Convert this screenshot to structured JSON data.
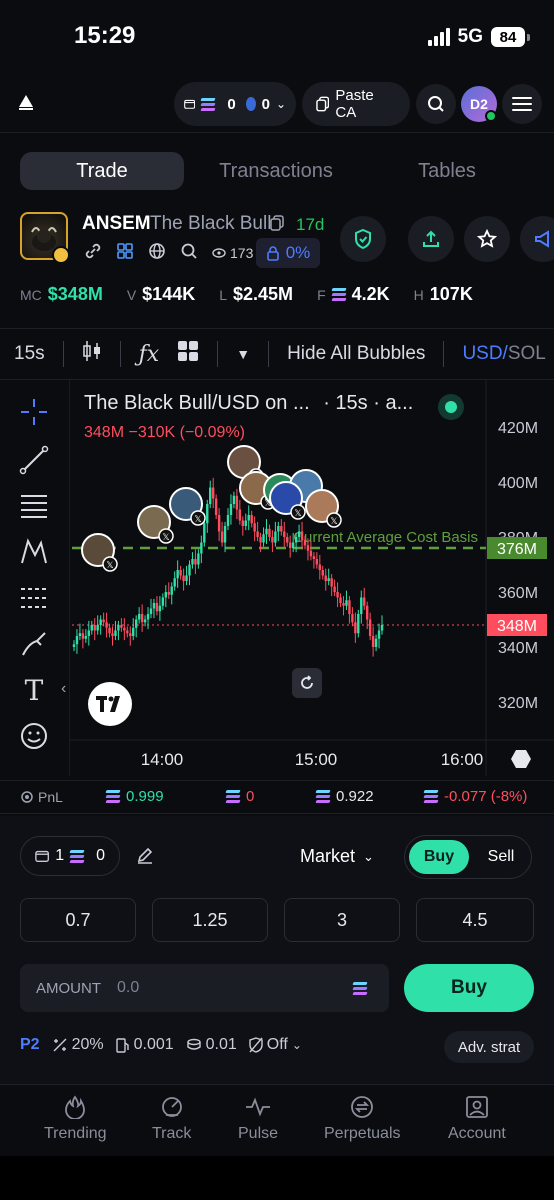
{
  "status": {
    "time": "15:29",
    "network": "5G",
    "battery": "84"
  },
  "header": {
    "wallet_count": "0",
    "points_count": "0",
    "paste_label": "Paste CA",
    "avatar_initials": "D2"
  },
  "tabs": [
    {
      "label": "Trade",
      "active": true
    },
    {
      "label": "Transactions",
      "active": false
    },
    {
      "label": "Tables",
      "active": false
    }
  ],
  "token": {
    "symbol": "ANSEM",
    "name": "The Black Bull",
    "age": "17d",
    "viewers": "173",
    "lock_pct": "0%"
  },
  "stats": [
    {
      "key": "MC",
      "value": "$348M",
      "color": "#2fe0a8"
    },
    {
      "key": "V",
      "value": "$144K",
      "color": "#ffffff"
    },
    {
      "key": "L",
      "value": "$2.45M",
      "color": "#ffffff"
    },
    {
      "key": "F",
      "value": "4.2K",
      "color": "#ffffff"
    },
    {
      "key": "H",
      "value": "107K",
      "color": "#ffffff"
    }
  ],
  "chart_toolbar": {
    "interval": "15s",
    "hide_bubbles": "Hide All Bubbles",
    "currency": "USD/SOL"
  },
  "chart": {
    "title": "The Black Bull/USD on ...",
    "subtitle": "· 15s · a...",
    "ohlc_line": "348M  −310K (−0.09%)",
    "avg_cost_label": "Current Average Cost Basis",
    "avg_cost_value": "376M",
    "current_value": "348M",
    "y_ticks": [
      "420M",
      "400M",
      "380M",
      "360M",
      "340M",
      "320M"
    ],
    "x_ticks": [
      "14:00",
      "15:00",
      "16:00"
    ]
  },
  "chart_data": {
    "type": "candlestick",
    "ylim": [
      310,
      430
    ],
    "y_unit": "M",
    "avg_cost": 376,
    "last": 348,
    "x_ticks": [
      "14:00",
      "15:00",
      "16:00"
    ],
    "close": [
      341,
      344,
      345,
      343,
      344,
      346,
      348,
      346,
      348,
      350,
      349,
      347,
      345,
      344,
      346,
      348,
      347,
      346,
      345,
      344,
      347,
      350,
      352,
      349,
      350,
      352,
      354,
      356,
      353,
      355,
      358,
      360,
      359,
      362,
      365,
      368,
      366,
      364,
      366,
      370,
      372,
      370,
      374,
      378,
      385,
      392,
      398,
      394,
      388,
      382,
      378,
      384,
      388,
      392,
      395,
      390,
      386,
      384,
      386,
      388,
      385,
      382,
      380,
      378,
      381,
      383,
      380,
      378,
      382,
      384,
      382,
      380,
      378,
      376,
      378,
      380,
      382,
      379,
      377,
      375,
      373,
      372,
      370,
      368,
      366,
      364,
      365,
      362,
      360,
      358,
      356,
      355,
      357,
      352,
      349,
      345,
      352,
      358,
      355,
      350,
      344,
      340,
      343,
      346,
      348
    ]
  },
  "pnl": {
    "label": "PnL",
    "values": [
      {
        "value": "0.999",
        "color": "#2fe0a8"
      },
      {
        "value": "0",
        "color": "#ff4d5e"
      },
      {
        "value": "0.922",
        "color": "#e6e8ee"
      },
      {
        "value": "-0.077 (-8%)",
        "color": "#ff4d5e"
      }
    ]
  },
  "trade": {
    "wallets": "1",
    "balance": "0",
    "order_type": "Market",
    "buy_tab": "Buy",
    "sell_tab": "Sell",
    "presets": [
      "0.7",
      "1.25",
      "3",
      "4.5"
    ],
    "amount_label": "AMOUNT",
    "amount_placeholder": "0.0",
    "buy_button": "Buy",
    "preset_name": "P2",
    "slippage": "20%",
    "priority": "0.001",
    "bribe": "0.01",
    "mev": "Off",
    "adv_strat": "Adv. strat"
  },
  "nav": [
    {
      "label": "Trending",
      "icon": "flame-icon"
    },
    {
      "label": "Track",
      "icon": "radar-icon"
    },
    {
      "label": "Pulse",
      "icon": "pulse-icon"
    },
    {
      "label": "Perpetuals",
      "icon": "perpetuals-icon"
    },
    {
      "label": "Account",
      "icon": "account-icon"
    }
  ],
  "colors": {
    "accent": "#2fe0a8",
    "down": "#ff4d5e",
    "blue": "#4d7cff",
    "avg_line": "#5f9f3f"
  }
}
